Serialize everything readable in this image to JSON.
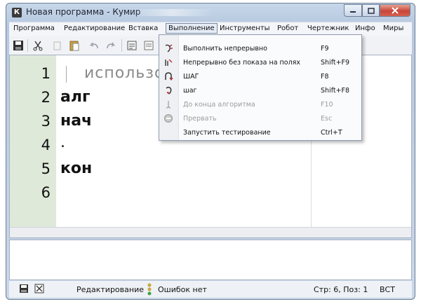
{
  "window": {
    "title": "Новая программа - Кумир",
    "icon_letter": "К"
  },
  "menubar": {
    "items": [
      "Программа",
      "Редактирование",
      "Вставка",
      "Выполнение",
      "Инструменты",
      "Робот",
      "Чертежник",
      "Инфо",
      "Миры"
    ],
    "active": "Выполнение"
  },
  "toolbar": {
    "icons": [
      "save-icon",
      "cut-icon",
      "paste-icon",
      "undo-icon",
      "redo-icon",
      "insert-line-icon"
    ]
  },
  "editor": {
    "line_numbers": [
      "1",
      "2",
      "3",
      "4",
      "5",
      "6"
    ],
    "lines": [
      {
        "text": "использо",
        "kind": "comment"
      },
      {
        "text": "алг",
        "kind": "keyword"
      },
      {
        "text": "нач",
        "kind": "keyword"
      },
      {
        "text": ".",
        "kind": "code"
      },
      {
        "text": "кон",
        "kind": "keyword"
      },
      {
        "text": "",
        "kind": "code"
      }
    ]
  },
  "run_menu": {
    "items": [
      {
        "label": "Выполнить непрерывно",
        "shortcut": "F9",
        "icon": "run-continuous-icon",
        "enabled": true
      },
      {
        "label": "Непрерывно без показа на полях",
        "shortcut": "Shift+F9",
        "icon": "run-blind-icon",
        "enabled": true
      },
      {
        "label": "ШАГ",
        "shortcut": "F8",
        "icon": "step-over-icon",
        "enabled": true
      },
      {
        "label": "шаг",
        "shortcut": "Shift+F8",
        "icon": "step-into-icon",
        "enabled": true
      },
      {
        "label": "До конца алгоритма",
        "shortcut": "F10",
        "icon": "step-out-icon",
        "enabled": false
      },
      {
        "label": "Прервать",
        "shortcut": "Esc",
        "icon": "stop-icon",
        "enabled": false
      },
      {
        "label": "Запустить тестирование",
        "shortcut": "Ctrl+T",
        "icon": "",
        "enabled": true
      }
    ]
  },
  "statusbar": {
    "mode": "Редактирование",
    "errors": "Ошибок нет",
    "position": "Стр: 6, Поз: 1",
    "insert_mode": "ВСТ"
  },
  "colors": {
    "gutter": "#dfe9da",
    "titlebar": "#c7d7ea",
    "close_button": "#c8453a"
  }
}
